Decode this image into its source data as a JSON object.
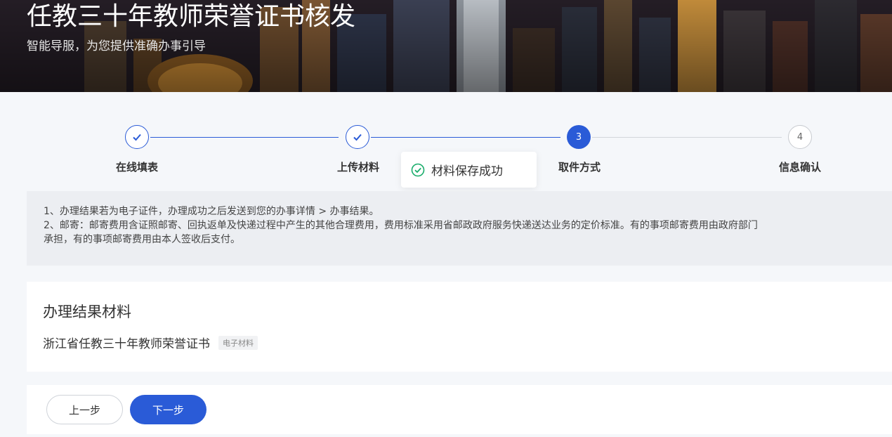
{
  "banner": {
    "title": "任教三十年教师荣誉证书核发",
    "subtitle": "智能导服，为您提供准确办事引导"
  },
  "steps": [
    {
      "label": "在线填表",
      "state": "done",
      "icon": "check-icon"
    },
    {
      "label": "上传材料",
      "state": "done",
      "icon": "check-icon"
    },
    {
      "label": "取件方式",
      "state": "active",
      "number": "3"
    },
    {
      "label": "信息确认",
      "state": "todo",
      "number": "4"
    }
  ],
  "toast": {
    "message": "材料保存成功",
    "icon": "check-circle-icon"
  },
  "notice": {
    "line1": "1、办理结果若为电子证件，办理成功之后发送到您的办事详情 > 办事结果。",
    "line2": "2、邮寄：邮寄费用含证照邮寄、回执返单及快递过程中产生的其他合理费用，费用标准采用省邮政政府服务快递送达业务的定价标准。有的事项邮寄费用由政府部门",
    "line3": "承担，有的事项邮寄费用由本人签收后支付。"
  },
  "result": {
    "title": "办理结果材料",
    "item_name": "浙江省任教三十年教师荣誉证书",
    "item_tag": "电子材料"
  },
  "buttons": {
    "prev": "上一步",
    "next": "下一步"
  },
  "colors": {
    "accent": "#2a5bd7",
    "success": "#1aad6b"
  }
}
